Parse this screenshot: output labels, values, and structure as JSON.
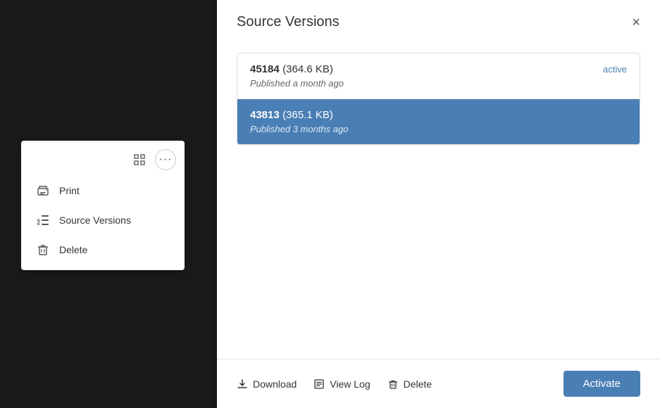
{
  "background": {
    "color": "#1a1a1a"
  },
  "context_menu": {
    "items": [
      {
        "id": "print",
        "label": "Print",
        "icon": "printer-icon"
      },
      {
        "id": "source-versions",
        "label": "Source Versions",
        "icon": "source-versions-icon"
      },
      {
        "id": "delete",
        "label": "Delete",
        "icon": "trash-icon"
      }
    ]
  },
  "modal": {
    "title": "Source Versions",
    "close_label": "×",
    "versions": [
      {
        "number": "45184",
        "size": "(364.6 KB)",
        "date": "Published a month ago",
        "badge": "active",
        "selected": false
      },
      {
        "number": "43813",
        "size": "(365.1 KB)",
        "date": "Published 3 months ago",
        "badge": "",
        "selected": true
      }
    ],
    "footer": {
      "download_label": "Download",
      "view_log_label": "View Log",
      "delete_label": "Delete",
      "activate_label": "Activate"
    }
  }
}
